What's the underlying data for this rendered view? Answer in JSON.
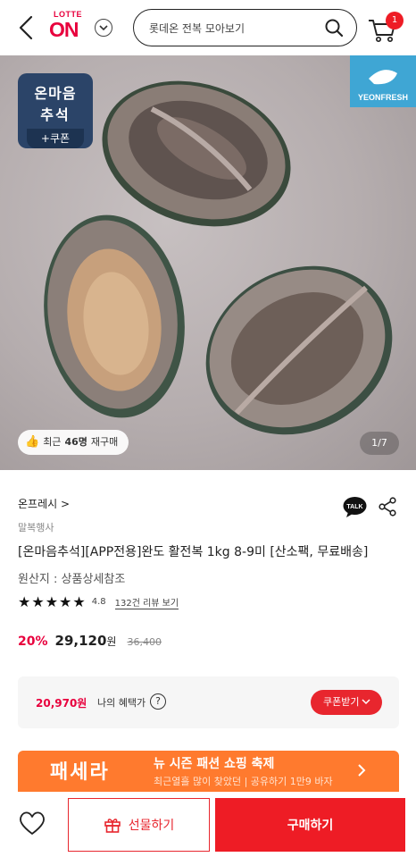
{
  "header": {
    "logo_top": "LOTTE",
    "logo_main": "ON",
    "search_text": "롯데온 전복 모아보기",
    "cart_count": "1"
  },
  "hero": {
    "promo": {
      "line1": "온마음",
      "line2": "추석",
      "line3": "+쿠폰"
    },
    "brand_name": "YEONFRESH",
    "repurchase_prefix": "최근",
    "repurchase_count": "46명",
    "repurchase_suffix": "재구매",
    "pager": "1/7"
  },
  "product": {
    "store": "온프레시 >",
    "seller": "말복행사",
    "title": "[온마음추석][APP전용]완도 활전복 1kg 8-9미 [산소팩, 무료배송]",
    "origin_label": "원산지 :",
    "origin_value": "상품상세참조",
    "rating": "4.8",
    "rating_stars": 5,
    "review_link": "132건 리뷰 보기",
    "discount": "20%",
    "price": "29,120",
    "won": "원",
    "original_price": "36,400"
  },
  "benefit": {
    "price": "20,970원",
    "label": "나의 혜택가",
    "help": "?",
    "coupon_button": "쿠폰받기"
  },
  "banner": {
    "brand": "패세라",
    "text": "뉴 시즌 패션 쇼핑 축제",
    "sub": "최근열흘 많이 찾았던 | 공유하기 1만9 바자"
  },
  "bottom_bar": {
    "gift_label": "선물하기",
    "buy_label": "구매하기"
  },
  "colors": {
    "accent": "#e8003d",
    "buy": "#ee1c25",
    "promo_badge": "#2b4468",
    "brand_logo": "#3fa6d4",
    "banner": "#ff7a2e"
  }
}
